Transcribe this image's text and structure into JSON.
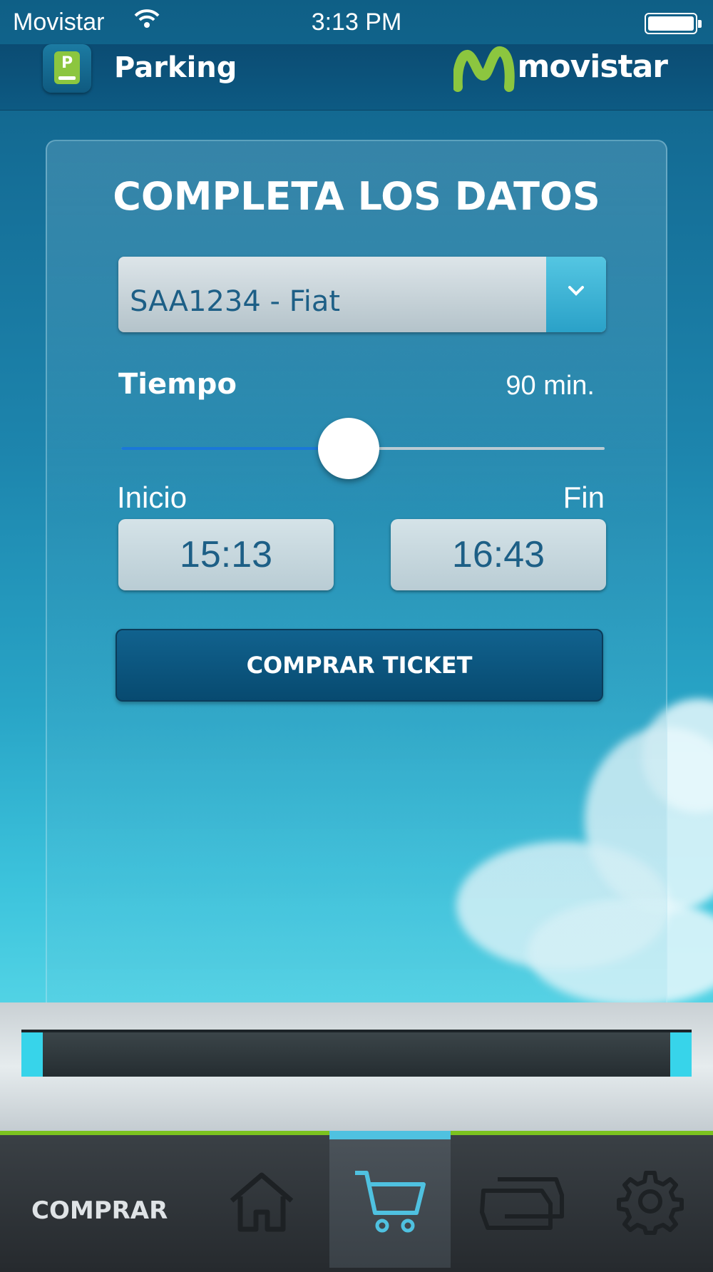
{
  "status_bar": {
    "carrier": "Movistar",
    "time": "3:13 PM"
  },
  "header": {
    "app_title": "Parking",
    "app_icon_letter": "P",
    "brand": "movistar"
  },
  "form": {
    "title": "COMPLETA LOS DATOS",
    "vehicle_selected": "SAA1234 - Fiat",
    "tiempo_label": "Tiempo",
    "tiempo_value": "90 min.",
    "slider_fraction": 0.47,
    "inicio_label": "Inicio",
    "fin_label": "Fin",
    "inicio_time": "15:13",
    "fin_time": "16:43",
    "buy_label": "COMPRAR TICKET"
  },
  "tabbar": {
    "section_label": "COMPRAR",
    "tabs": [
      {
        "icon": "home-icon",
        "active": false
      },
      {
        "icon": "cart-icon",
        "active": true
      },
      {
        "icon": "tickets-icon",
        "active": false
      },
      {
        "icon": "gear-icon",
        "active": false
      }
    ]
  },
  "colors": {
    "accent_green": "#7cc31f",
    "accent_cyan": "#4fc1e0",
    "header_blue": "#0d5a83"
  }
}
